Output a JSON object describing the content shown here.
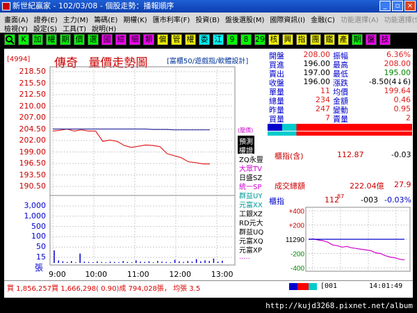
{
  "window": {
    "title": "新世紀贏家 - 102/03/08 - 個股走勢：播報順序",
    "buttons": {
      "minimize": "_",
      "restore": "▫",
      "close": "×"
    }
  },
  "menu": {
    "row1": [
      "畫面(A)",
      "證券(E)",
      "主力(M)",
      "籌碼(E)",
      "期權(K)",
      "匯市利率(F)",
      "投資(B)",
      "盤後選股(M)",
      "國際資訊(I)",
      "金融(C)",
      "功能選擇(A)",
      "功能選擇(S)"
    ],
    "row2": [
      "檢視(Y)",
      "設定(S)",
      "工具(T)",
      "說明(H)"
    ]
  },
  "toolbar": {
    "buttons": [
      {
        "label": "",
        "color": "#00ff00",
        "icon": "search-icon"
      },
      {
        "label": "K",
        "color": "#00ff00"
      },
      {
        "label": "加",
        "color": "#00ff00"
      },
      {
        "label": "權",
        "color": "#00ff00"
      },
      {
        "label": "期",
        "color": "#00ff00"
      },
      {
        "label": "價",
        "color": "#00ff00"
      },
      {
        "label": "選",
        "color": "#00ff00"
      },
      {
        "label": "國",
        "color": "#ff00ff"
      },
      {
        "label": "綜",
        "color": "#ff00ff"
      },
      {
        "label": "細",
        "color": "#ff00ff"
      },
      {
        "label": "類",
        "color": "#ff00ff"
      },
      {
        "label": "偏",
        "color": "#ffff00"
      },
      {
        "label": "管",
        "color": "#ffff00"
      },
      {
        "label": "權",
        "color": "#ffff00"
      },
      {
        "label": "委",
        "color": "#00ffff"
      },
      {
        "label": "江",
        "color": "#00ffff"
      },
      {
        "label": "9",
        "color": "#00ff00"
      },
      {
        "label": "8",
        "color": "#00ff00"
      },
      {
        "label": "29",
        "color": "#00ff00"
      },
      {
        "label": "核",
        "color": "#ffff00"
      },
      {
        "label": "興",
        "color": "#ffff00"
      },
      {
        "label": "指",
        "color": "#ffff00"
      },
      {
        "label": "團",
        "color": "#ffff00"
      },
      {
        "label": "鑑",
        "color": "#ffff00"
      },
      {
        "label": "產",
        "color": "#ffff00"
      },
      {
        "label": "期",
        "color": "#00ff00"
      },
      {
        "label": "盤",
        "color": "#ff00ff"
      },
      {
        "label": "技",
        "color": "#ff00ff"
      }
    ]
  },
  "chart": {
    "stock_code": "[4994]",
    "stock_name": "傳奇",
    "chart_title": "量價走勢圖",
    "subtitle": "[富櫃50/遊戲指/軟體設計]",
    "price_labels": [
      "218.50",
      "215.50",
      "212.50",
      "210.00",
      "207.00",
      "204.50",
      "202.00",
      "199.00",
      "196.50",
      "193.50",
      "190.50"
    ],
    "volume_labels": [
      "3,000",
      "1,000",
      "500",
      "100",
      "50",
      "15"
    ],
    "volume_unit": "張",
    "time_labels": [
      "9:00",
      "10:00",
      "11:00",
      "12:00",
      "13:00"
    ],
    "ref_line_label": "(壓價)",
    "colors": {
      "price": "#e02020",
      "average": "#3030a0",
      "grid": "#aaaaaa",
      "volume": "#0000cc"
    }
  },
  "chart_data": [
    {
      "type": "line",
      "title": "量價走勢圖",
      "xlabel": "",
      "ylabel": "",
      "ylim": [
        190.5,
        218.5
      ],
      "x": [
        "9:00",
        "9:10",
        "9:20",
        "9:30",
        "9:40",
        "9:50",
        "10:00",
        "10:05",
        "10:15",
        "10:30",
        "10:45",
        "11:00",
        "11:15",
        "11:30",
        "11:45",
        "12:00",
        "12:15",
        "12:30",
        "12:45",
        "13:00",
        "13:10",
        "13:20",
        "13:30"
      ],
      "series": [
        {
          "values": [
            204.0,
            204.2,
            204.5,
            204.0,
            204.3,
            204.0,
            204.0,
            201.5,
            201.8,
            201.5,
            200.5,
            200.0,
            200.3,
            200.6,
            200.5,
            200.2,
            198.5,
            198.0,
            197.5,
            196.5,
            196.3,
            196.0,
            196.0
          ]
        },
        {
          "values": [
            204.5,
            204.5,
            204.5,
            204.5,
            204.5,
            204.5,
            204.5,
            204.5,
            204.5,
            204.5,
            204.5,
            204.5,
            204.5,
            204.5,
            204.4,
            204.4,
            204.4,
            204.3,
            204.3,
            204.3,
            204.3,
            204.3,
            204.3
          ]
        }
      ]
    },
    {
      "type": "line",
      "title": "",
      "ylim": [
        -400,
        400
      ],
      "yticks": [
        "+400",
        "+200",
        "11290",
        "-200",
        "-400"
      ],
      "x": [
        0,
        1,
        2,
        3,
        4,
        5,
        6,
        7,
        8,
        9,
        10,
        11,
        12,
        13,
        14,
        15,
        16,
        17,
        18,
        19,
        20
      ],
      "series": [
        {
          "values": [
            0,
            5,
            -10,
            -20,
            -40,
            -80,
            -90,
            -110,
            -100,
            -120,
            -130,
            -140,
            -150,
            -160,
            -190,
            -200,
            -230,
            -250,
            -260,
            -280,
            -290
          ]
        },
        {
          "values": [
            0,
            0,
            0,
            0,
            0,
            0,
            0,
            0,
            0,
            0,
            0,
            0,
            0,
            0,
            0,
            0,
            0,
            0,
            0,
            0,
            0
          ]
        }
      ]
    }
  ],
  "controls": [
    {
      "label": "預測",
      "color": "#ffffff",
      "bg": "#000000"
    },
    {
      "label": "權證",
      "color": "#ffffff",
      "bg": "#000000"
    },
    {
      "label": "ZQ永豐",
      "color": "#000000",
      "bg": "#ffffff"
    },
    {
      "label": "大眾TV",
      "color": "#cc00cc",
      "bg": "#ffffff"
    },
    {
      "label": "日盛SZ",
      "color": "#000000",
      "bg": "#ffffff"
    },
    {
      "label": "統一SP",
      "color": "#cc00cc",
      "bg": "#ffffff"
    },
    {
      "label": "群益UY",
      "color": "#009999",
      "bg": "#ffffff"
    },
    {
      "label": "元富XX",
      "color": "#009999",
      "bg": "#ffffff"
    },
    {
      "label": "工銀XZ",
      "color": "#000000",
      "bg": "#ffffff"
    },
    {
      "label": "RD元大",
      "color": "#000000",
      "bg": "#ffffff"
    },
    {
      "label": "群益UQ",
      "color": "#000000",
      "bg": "#ffffff"
    },
    {
      "label": "元富XQ",
      "color": "#000000",
      "bg": "#ffffff"
    },
    {
      "label": "元富XP",
      "color": "#000000",
      "bg": "#ffffff"
    },
    {
      "label": ".....",
      "color": "#cc00cc",
      "bg": "#ffffff"
    }
  ],
  "quote": {
    "rows": [
      {
        "l1": "開盤",
        "v1": "208.00",
        "l2": "振幅",
        "v2": "6.36%",
        "c1": "#e02020",
        "c2": "#e02020"
      },
      {
        "l1": "買進",
        "v1": "196.00",
        "l2": "最高",
        "v2": "208.00",
        "c1": "#000000",
        "c2": "#e02020"
      },
      {
        "l1": "賣出",
        "v1": "197.00",
        "l2": "最低",
        "v2": "195.00",
        "c1": "#000000",
        "c2": "#008800"
      },
      {
        "l1": "收盤",
        "v1": "196.00",
        "l2": "漲跌",
        "v2": "-8.50(4↓6)",
        "c1": "#000000",
        "c2": "#000000"
      },
      {
        "l1": "單量",
        "v1": "11",
        "l2": "均價",
        "v2": "199.64",
        "c1": "#e02020",
        "c2": "#e02020"
      },
      {
        "l1": "總量",
        "v1": "234",
        "l2": "金額",
        "v2": "0.46",
        "c1": "#e02020",
        "c2": "#e02020"
      },
      {
        "l1": "昨量",
        "v1": "247",
        "l2": "變動",
        "v2": "0.95",
        "c1": "#e02020",
        "c2": "#e02020"
      },
      {
        "l1": "買量",
        "v1": "7",
        "l2": "賣量",
        "v2": "2",
        "c1": "#e02020",
        "c2": "#e02020"
      }
    ],
    "index_label": "櫃指(含)",
    "index_value": "112.87",
    "index_change": "-0.03",
    "total_label": "成交總額",
    "total_value": "222.04億",
    "total_ratio": "27.9",
    "otc_label": "櫃指",
    "otc_value": "112",
    "otc_sup": "87",
    "otc_change": "-003",
    "otc_pct": "-0.03%"
  },
  "status": {
    "text": "買 1,856,257買 1,666,298( 0.90)成 794,028張， 均張 3.5",
    "code": "[001",
    "time": "14:01:49"
  },
  "footer": {
    "url": "http://kujd3268.pixnet.net/album"
  }
}
